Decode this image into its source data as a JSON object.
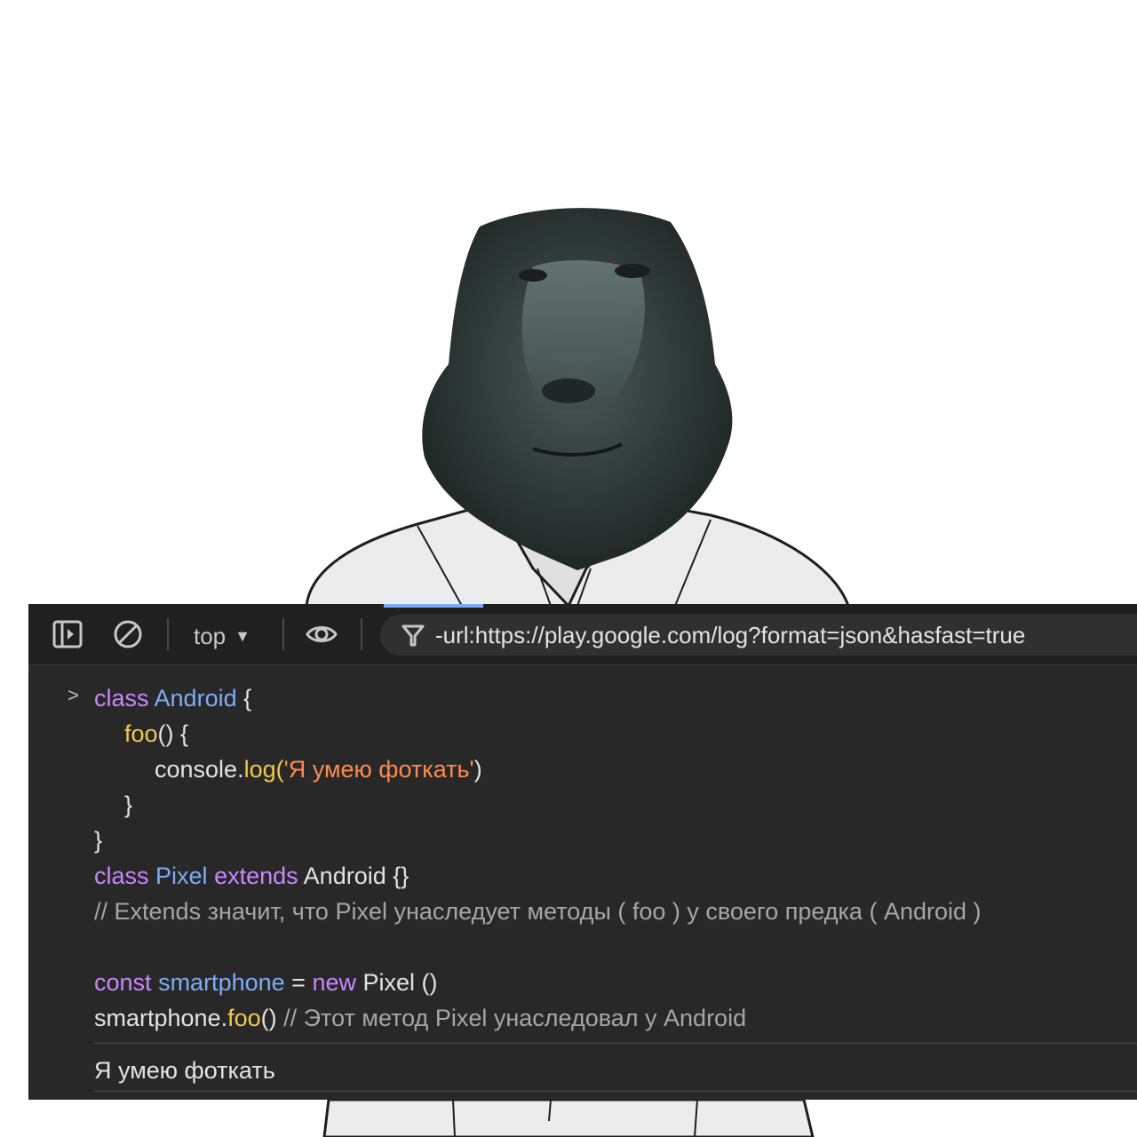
{
  "toolbar": {
    "context_label": "top",
    "context_caret": "▼",
    "filter_value": "-url:https://play.google.com/log?format=json&hasfast=true",
    "icons": [
      "sidebar-toggle-icon",
      "clear-console-icon",
      "eye-icon",
      "filter-icon"
    ]
  },
  "console": {
    "prompt_symbol": ">",
    "code": {
      "l1": {
        "kw": "class",
        "name": "Android",
        "rest": " {"
      },
      "l2": {
        "fn": "foo",
        "rest": "() {"
      },
      "l3": {
        "obj": "console.",
        "fn": "log",
        "open": "(",
        "str": "'Я умею фоткать'",
        "close": ")"
      },
      "l4": "}",
      "l5": "}",
      "l6": {
        "kw": "class",
        "name": "Pixel",
        "kw2": "extends",
        "rest": " Android {}"
      },
      "l7": "// Extends значит, что Pixel унаследует методы ( foo ) у своего предка ( Android )",
      "l9": {
        "kw": "const",
        "name": "smartphone",
        "eq": " = ",
        "kw2": "new",
        "rest": " Pixel ()"
      },
      "l10": {
        "obj": "smartphone.",
        "fn": "foo",
        "call": "()",
        "comment": " // Этот метод Pixel унаследовал у Android"
      }
    },
    "output": "Я умею фоткать"
  },
  "colors": {
    "background": "#282828",
    "toolbar": "#202020",
    "keyword": "#c986ff",
    "class_name": "#7cacf8",
    "function": "#f0c94f",
    "string": "#ff8a50",
    "comment": "#a6a6a6",
    "text": "#e3e3e3"
  }
}
